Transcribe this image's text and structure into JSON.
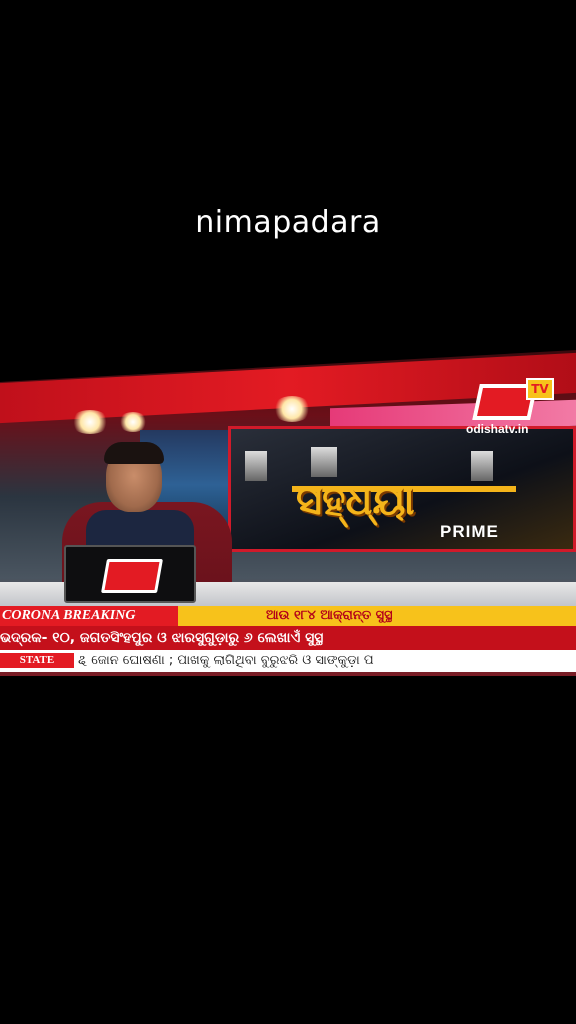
{
  "caption": "nimapadara",
  "channel": {
    "website": "odishatv.in",
    "logo_badge": "TV"
  },
  "show": {
    "title": "ସହ୍ଧ୍ୟା",
    "subtitle": "PRIME"
  },
  "tickers": {
    "breaking_label": "CORONA BREAKING",
    "breaking_headline": "ଆଉ ୧୮୪ ଆକ୍ରାନ୍ତ ସୁସ୍ଥ",
    "line2": "ଭଦ୍ରକ- ୧୦, ଜଗତସିଂହପୁର ଓ ଝାରସୁଗୁଡ଼ାରୁ ୬ ଲେଖାଏଁ ସୁସ୍ଥ",
    "state_label": "STATE",
    "line3": "ୡ ଜୋନ ଘୋଷଣା ; ପାଖକୁ ଲାଗିଥିବା ବୁରୁଝରି ଓ ସାଙ୍କୁଡ଼ା ପ"
  },
  "colors": {
    "brand_red": "#e31b23",
    "brand_yellow": "#f7c21b",
    "title_gold": "#f4b41a"
  }
}
